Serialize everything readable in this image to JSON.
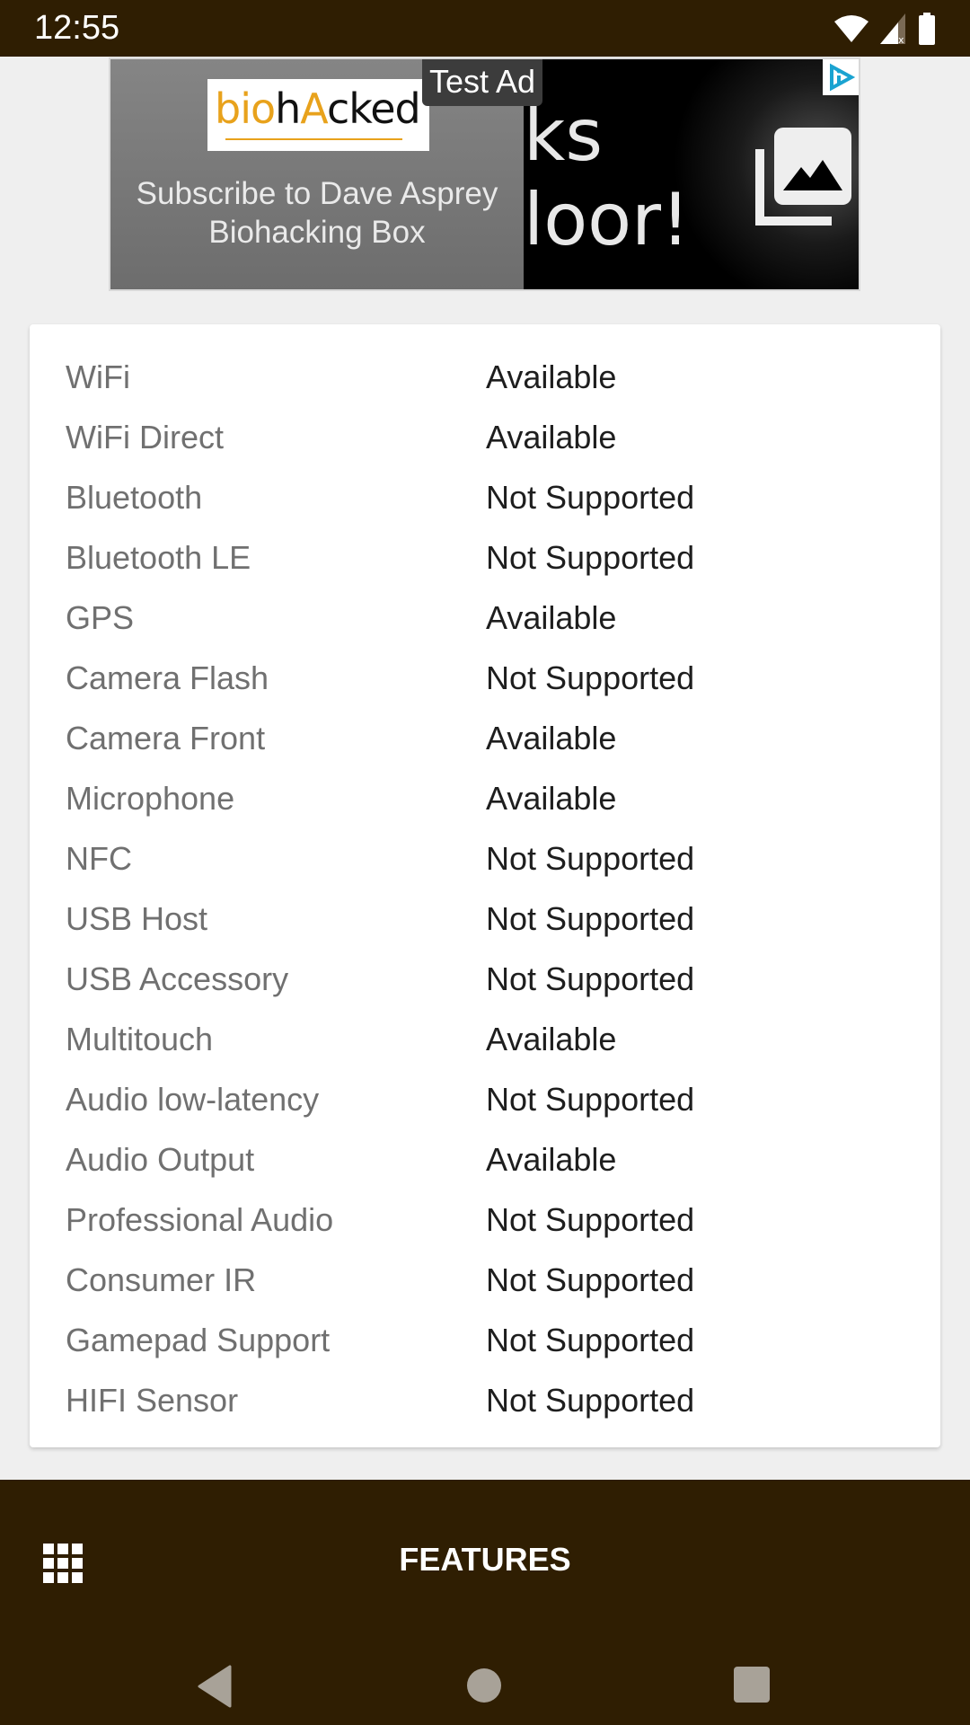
{
  "status_bar": {
    "time": "12:55",
    "icons": [
      "wifi-icon",
      "signal-no-data-icon",
      "battery-icon"
    ]
  },
  "ad": {
    "label": "Test Ad",
    "logo_part1": "bio",
    "logo_part2": "h",
    "logo_part3": "A",
    "logo_part4": "cked",
    "headline": "Subscribe to Dave Asprey Biohacking Box",
    "background_text_line1": "ks",
    "background_text_line2": "loor!",
    "choices_icon": "ad-choices-icon",
    "gallery_icon": "image-gallery-icon",
    "expand_icon": "expand-icon"
  },
  "features": [
    {
      "name": "WiFi",
      "status": "Available"
    },
    {
      "name": "WiFi Direct",
      "status": "Available"
    },
    {
      "name": "Bluetooth",
      "status": "Not Supported"
    },
    {
      "name": "Bluetooth LE",
      "status": "Not Supported"
    },
    {
      "name": "GPS",
      "status": "Available"
    },
    {
      "name": "Camera Flash",
      "status": "Not Supported"
    },
    {
      "name": "Camera Front",
      "status": "Available"
    },
    {
      "name": "Microphone",
      "status": "Available"
    },
    {
      "name": "NFC",
      "status": "Not Supported"
    },
    {
      "name": "USB Host",
      "status": "Not Supported"
    },
    {
      "name": "USB Accessory",
      "status": "Not Supported"
    },
    {
      "name": "Multitouch",
      "status": "Available"
    },
    {
      "name": "Audio low-latency",
      "status": "Not Supported"
    },
    {
      "name": "Audio Output",
      "status": "Available"
    },
    {
      "name": "Professional Audio",
      "status": "Not Supported"
    },
    {
      "name": "Consumer IR",
      "status": "Not Supported"
    },
    {
      "name": "Gamepad Support",
      "status": "Not Supported"
    },
    {
      "name": "HIFI Sensor",
      "status": "Not Supported"
    }
  ],
  "bottom_bar": {
    "title": "FEATURES",
    "menu_icon": "apps-grid-icon"
  },
  "nav": {
    "back": "back-icon",
    "home": "home-icon",
    "recents": "recents-icon"
  },
  "colors": {
    "bar_bg": "#2f1e02",
    "page_bg": "#efefef",
    "label_text": "#707070",
    "value_text": "#1e1e1e",
    "logo_orange": "#e8a21c"
  }
}
